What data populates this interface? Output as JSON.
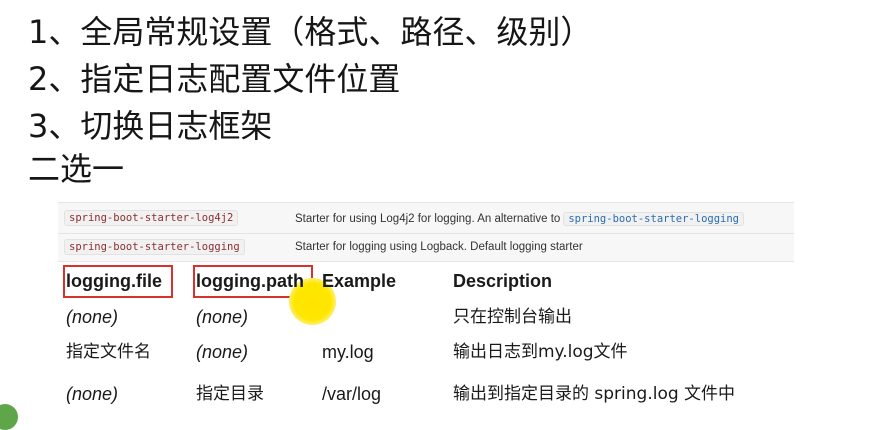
{
  "headings": [
    "1、全局常规设置（格式、路径、级别）",
    "2、指定日志配置文件位置",
    "3、切换日志框架",
    "二选一"
  ],
  "starters": [
    {
      "name": "spring-boot-starter-log4j2",
      "description": "Starter for using Log4j2 for logging. An alternative to",
      "link": "spring-boot-starter-logging"
    },
    {
      "name": "spring-boot-starter-logging",
      "description": "Starter for logging using Logback. Default logging starter"
    }
  ],
  "properties_table": {
    "headers": [
      "logging.file",
      "logging.path",
      "Example",
      "Description"
    ],
    "rows": [
      [
        "(none)",
        "(none)",
        "",
        "只在控制台输出"
      ],
      [
        "指定文件名",
        "(none)",
        "my.log",
        "输出日志到my.log文件"
      ],
      [
        "(none)",
        "指定目录",
        "/var/log",
        "输出到指定目录的 spring.log 文件中"
      ]
    ]
  },
  "colors": {
    "highlight_box": "#d9322d",
    "cursor_highlight": "#ffe400",
    "starter_name": "#8b2f2f",
    "starter_link": "#2a6db0"
  }
}
